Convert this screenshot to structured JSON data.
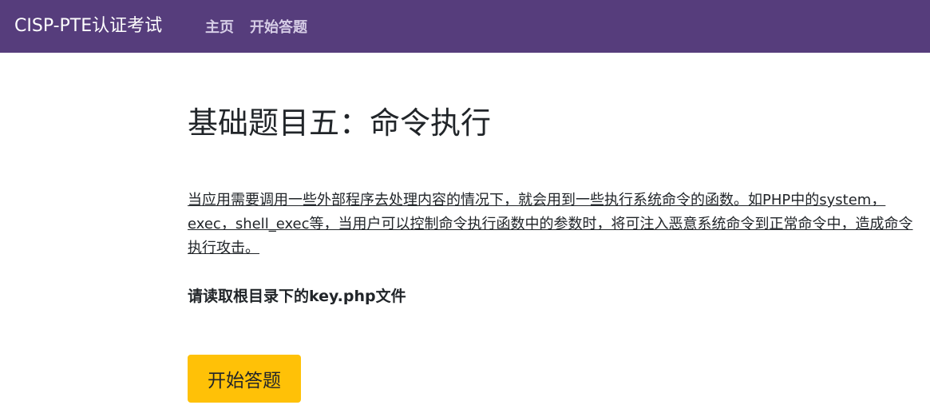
{
  "navbar": {
    "brand": "CISP-PTE认证考试",
    "links": [
      {
        "label": "主页"
      },
      {
        "label": "开始答题"
      }
    ],
    "background_color": "#563d7c"
  },
  "main": {
    "title": "基础题目五：命令执行",
    "description": "当应用需要调用一些外部程序去处理内容的情况下，就会用到一些执行系统命令的函数。如PHP中的system，exec，shell_exec等，当用户可以控制命令执行函数中的参数时，将可注入恶意系统命令到正常命令中，造成命令执行攻击。",
    "task": "请读取根目录下的key.php文件",
    "start_button": "开始答题",
    "button_color": "#ffc107"
  }
}
